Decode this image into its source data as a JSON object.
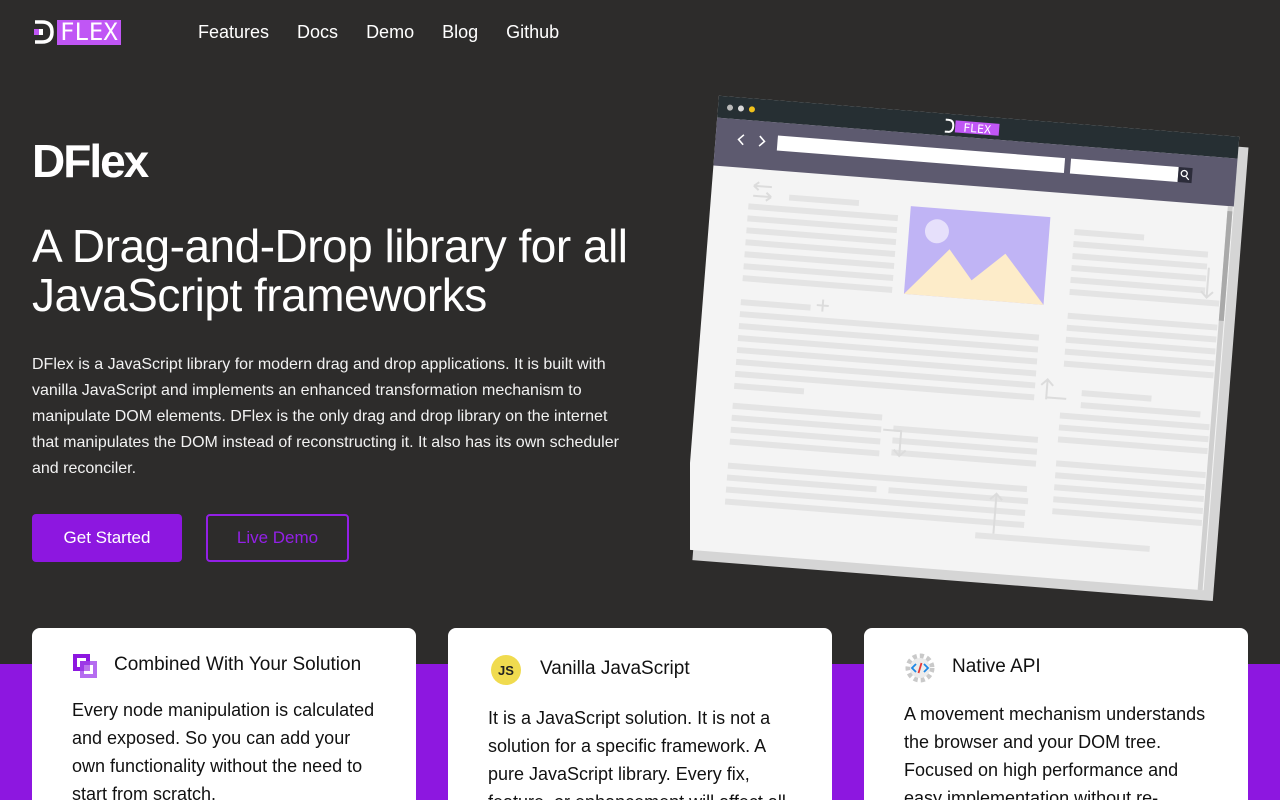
{
  "brand": {
    "logo_text": "FLEX"
  },
  "nav": {
    "links": [
      "Features",
      "Docs",
      "Demo",
      "Blog",
      "Github"
    ]
  },
  "hero": {
    "title": "DFlex",
    "subtitle": "A Drag-and-Drop library for all JavaScript frameworks",
    "description": "DFlex is a JavaScript library for modern drag and drop applications. It is built with vanilla JavaScript and implements an enhanced transformation mechanism to manipulate DOM elements. DFlex is the only drag and drop library on the internet that manipulates the DOM instead of reconstructing it. It also has its own scheduler and reconciler.",
    "primary_button": "Get Started",
    "secondary_button": "Live Demo"
  },
  "illustration": {
    "logo_text": "FLEX"
  },
  "features": [
    {
      "icon": "combined-squares-icon",
      "title": "Combined With Your Solution",
      "body": "Every node manipulation is calculated and exposed. So you can add your own functionality without the need to start from scratch."
    },
    {
      "icon": "javascript-icon",
      "icon_text": "JS",
      "title": "Vanilla JavaScript",
      "body": "It is a JavaScript solution. It is not a solution for a specific framework. A pure JavaScript library. Every fix, feature, or enhancement will affect all"
    },
    {
      "icon": "code-gear-icon",
      "title": "Native API",
      "body": "A movement mechanism understands the browser and your DOM tree. Focused on high performance and easy implementation without re-"
    }
  ],
  "colors": {
    "background": "#2d2c2b",
    "accent": "#8d17e0",
    "logo_bg": "#c056f5",
    "js_yellow": "#f0db4f"
  }
}
